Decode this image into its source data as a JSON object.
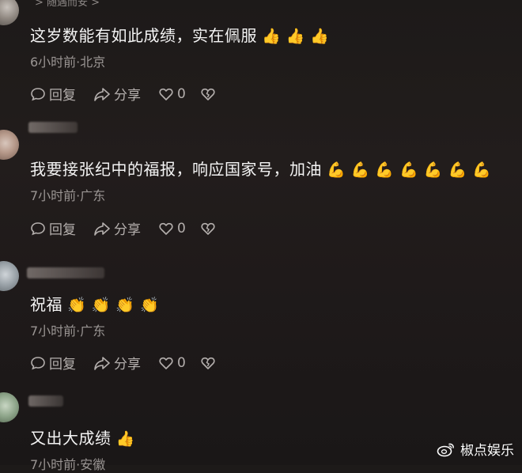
{
  "comments": [
    {
      "username": "> 随遇而安 >",
      "text": "这岁数能有如此成绩，实在佩服",
      "emoji": "👍 👍 👍",
      "time": "6小时前",
      "location": "北京",
      "meta": "6小时前·北京",
      "reply_label": "回复",
      "share_label": "分享",
      "likes": "0"
    },
    {
      "username": "",
      "text": "我要接张纪中的福报，响应国家号，加油",
      "emoji": "💪 💪 💪 💪 💪 💪 💪",
      "time": "7小时前",
      "location": "广东",
      "meta": "7小时前·广东",
      "reply_label": "回复",
      "share_label": "分享",
      "likes": "0"
    },
    {
      "username": "",
      "text": "祝福",
      "emoji": "👏 👏 👏 👏",
      "time": "7小时前",
      "location": "广东",
      "meta": "7小时前·广东",
      "reply_label": "回复",
      "share_label": "分享",
      "likes": "0"
    },
    {
      "username": "",
      "text": "又出大成绩",
      "emoji": "👍",
      "time": "7小时前",
      "location": "安徽",
      "meta": "7小时前·安徽"
    }
  ],
  "watermark": {
    "text": "椒点娱乐",
    "icon": "weibo-logo-icon"
  },
  "colors": {
    "text": "#f4f4f4",
    "meta": "#9a9593",
    "action": "#b4afad",
    "background": "#1f1a1a"
  }
}
